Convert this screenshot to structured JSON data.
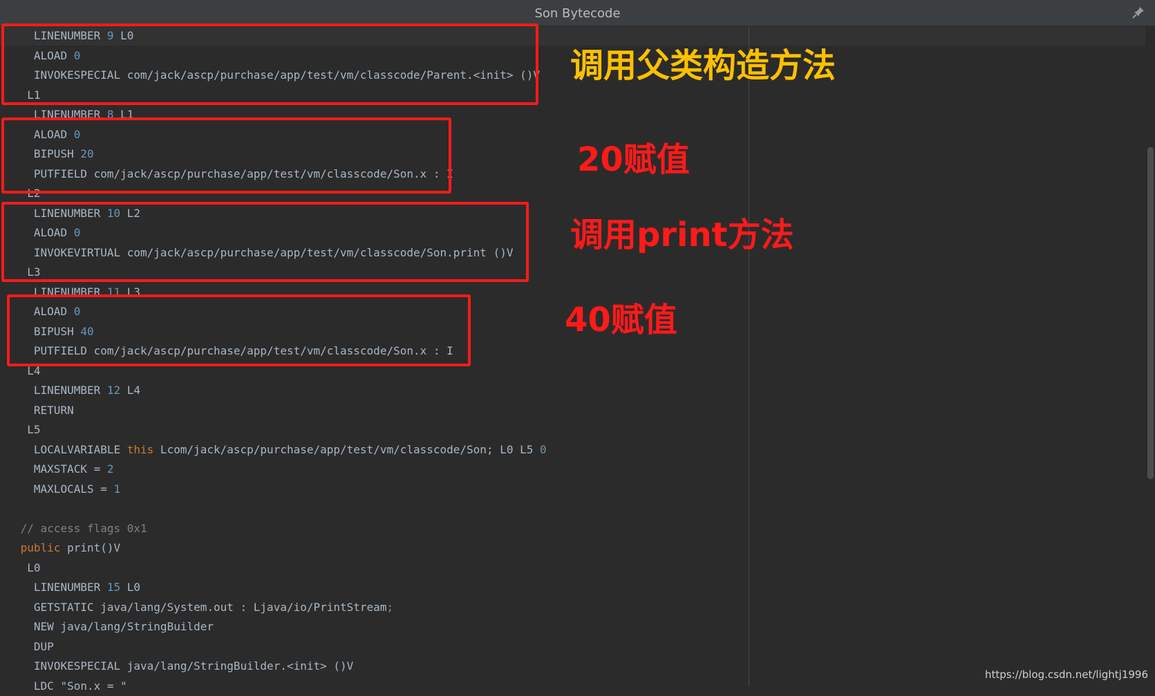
{
  "window": {
    "title": "Son Bytecode",
    "pin_icon": "pin-icon"
  },
  "colors": {
    "background": "#2b2b2b",
    "text": "#a9b7c6",
    "number": "#6897bb",
    "keyword": "#cc7832",
    "comment": "#808080",
    "annotation_box": "#ff1a1a",
    "annotation_yellow": "#ffc000",
    "annotation_red": "#ff1a1a"
  },
  "code_lines": [
    {
      "indent": "   ",
      "tokens": [
        [
          "t",
          "LINENUMBER "
        ],
        [
          "n",
          "9"
        ],
        [
          "t",
          " L0"
        ]
      ]
    },
    {
      "indent": "   ",
      "tokens": [
        [
          "t",
          "ALOAD "
        ],
        [
          "n",
          "0"
        ]
      ]
    },
    {
      "indent": "   ",
      "tokens": [
        [
          "t",
          "INVOKESPECIAL com/jack/ascp/purchase/app/test/vm/classcode/Parent.<init> ()V"
        ]
      ]
    },
    {
      "indent": "  ",
      "tokens": [
        [
          "t",
          "L1"
        ]
      ]
    },
    {
      "indent": "   ",
      "tokens": [
        [
          "t",
          "LINENUMBER "
        ],
        [
          "n",
          "8"
        ],
        [
          "t",
          " L1"
        ]
      ]
    },
    {
      "indent": "   ",
      "tokens": [
        [
          "t",
          "ALOAD "
        ],
        [
          "n",
          "0"
        ]
      ]
    },
    {
      "indent": "   ",
      "tokens": [
        [
          "t",
          "BIPUSH "
        ],
        [
          "n",
          "20"
        ]
      ]
    },
    {
      "indent": "   ",
      "tokens": [
        [
          "t",
          "PUTFIELD com/jack/ascp/purchase/app/test/vm/classcode/Son.x : I"
        ]
      ]
    },
    {
      "indent": "  ",
      "tokens": [
        [
          "t",
          "L2"
        ]
      ]
    },
    {
      "indent": "   ",
      "tokens": [
        [
          "t",
          "LINENUMBER "
        ],
        [
          "n",
          "10"
        ],
        [
          "t",
          " L2"
        ]
      ]
    },
    {
      "indent": "   ",
      "tokens": [
        [
          "t",
          "ALOAD "
        ],
        [
          "n",
          "0"
        ]
      ]
    },
    {
      "indent": "   ",
      "tokens": [
        [
          "t",
          "INVOKEVIRTUAL com/jack/ascp/purchase/app/test/vm/classcode/Son.print ()V"
        ]
      ]
    },
    {
      "indent": "  ",
      "tokens": [
        [
          "t",
          "L3"
        ]
      ]
    },
    {
      "indent": "   ",
      "tokens": [
        [
          "t",
          "LINENUMBER "
        ],
        [
          "n",
          "11"
        ],
        [
          "t",
          " L3"
        ]
      ]
    },
    {
      "indent": "   ",
      "tokens": [
        [
          "t",
          "ALOAD "
        ],
        [
          "n",
          "0"
        ]
      ]
    },
    {
      "indent": "   ",
      "tokens": [
        [
          "t",
          "BIPUSH "
        ],
        [
          "n",
          "40"
        ]
      ]
    },
    {
      "indent": "   ",
      "tokens": [
        [
          "t",
          "PUTFIELD com/jack/ascp/purchase/app/test/vm/classcode/Son.x : I"
        ]
      ]
    },
    {
      "indent": "  ",
      "tokens": [
        [
          "t",
          "L4"
        ]
      ]
    },
    {
      "indent": "   ",
      "tokens": [
        [
          "t",
          "LINENUMBER "
        ],
        [
          "n",
          "12"
        ],
        [
          "t",
          " L4"
        ]
      ]
    },
    {
      "indent": "   ",
      "tokens": [
        [
          "t",
          "RETURN"
        ]
      ]
    },
    {
      "indent": "  ",
      "tokens": [
        [
          "t",
          "L5"
        ]
      ]
    },
    {
      "indent": "   ",
      "tokens": [
        [
          "t",
          "LOCALVARIABLE "
        ],
        [
          "k",
          "this"
        ],
        [
          "t",
          " Lcom/jack/ascp/purchase/app/test/vm/classcode/Son; L0 L5 "
        ],
        [
          "n",
          "0"
        ]
      ]
    },
    {
      "indent": "   ",
      "tokens": [
        [
          "t",
          "MAXSTACK = "
        ],
        [
          "n",
          "2"
        ]
      ]
    },
    {
      "indent": "   ",
      "tokens": [
        [
          "t",
          "MAXLOCALS = "
        ],
        [
          "n",
          "1"
        ]
      ]
    },
    {
      "indent": "",
      "tokens": []
    },
    {
      "indent": " ",
      "tokens": [
        [
          "c",
          "// access flags 0x1"
        ]
      ]
    },
    {
      "indent": " ",
      "tokens": [
        [
          "k",
          "public"
        ],
        [
          "t",
          " print()V"
        ]
      ]
    },
    {
      "indent": "  ",
      "tokens": [
        [
          "t",
          "L0"
        ]
      ]
    },
    {
      "indent": "   ",
      "tokens": [
        [
          "t",
          "LINENUMBER "
        ],
        [
          "n",
          "15"
        ],
        [
          "t",
          " L0"
        ]
      ]
    },
    {
      "indent": "   ",
      "tokens": [
        [
          "t",
          "GETSTATIC java/lang/System.out : Ljava/io/PrintStream"
        ],
        [
          "k",
          ";"
        ]
      ]
    },
    {
      "indent": "   ",
      "tokens": [
        [
          "t",
          "NEW java/lang/StringBuilder"
        ]
      ]
    },
    {
      "indent": "   ",
      "tokens": [
        [
          "t",
          "DUP"
        ]
      ]
    },
    {
      "indent": "   ",
      "tokens": [
        [
          "t",
          "INVOKESPECIAL java/lang/StringBuilder.<init> ()V"
        ]
      ]
    },
    {
      "indent": "   ",
      "tokens": [
        [
          "t",
          "LDC \"Son.x = \""
        ]
      ]
    }
  ],
  "annotations": [
    {
      "text": "调用父类构造方法",
      "color": "#ffc000"
    },
    {
      "text": "20赋值",
      "color": "#ff1a1a"
    },
    {
      "text": "调用print方法",
      "color": "#ff1a1a"
    },
    {
      "text": "40赋值",
      "color": "#ff1a1a"
    }
  ],
  "watermark": "https://blog.csdn.net/lightj1996"
}
